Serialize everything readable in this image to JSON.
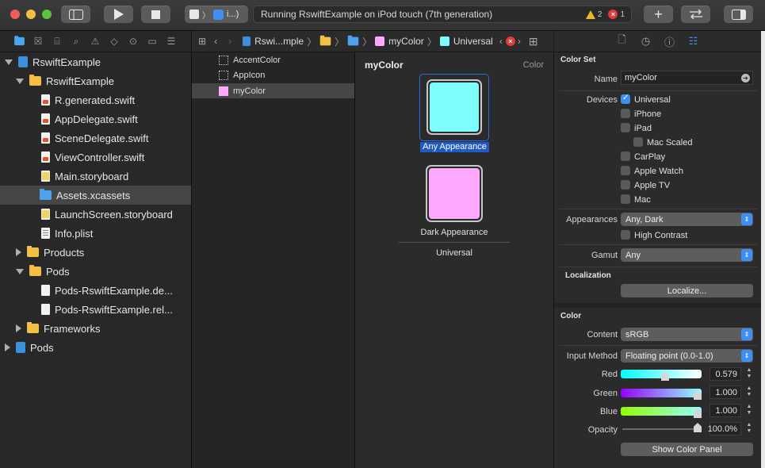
{
  "toolbar": {
    "status_text": "Running RswiftExample on iPod touch (7th generation)",
    "scheme_label": "i...)",
    "warning_count": "2",
    "error_count": "1",
    "colors": {
      "close": "#ee5d57",
      "minimize": "#f5bd3f",
      "zoom": "#5fc43d"
    }
  },
  "navigator": {
    "items": [
      {
        "label": "RswiftExample",
        "icon": "project-icon"
      },
      {
        "label": "RswiftExample",
        "icon": "folder-icon"
      },
      {
        "label": "R.generated.swift",
        "icon": "swift-file-icon"
      },
      {
        "label": "AppDelegate.swift",
        "icon": "swift-file-icon"
      },
      {
        "label": "SceneDelegate.swift",
        "icon": "swift-file-icon"
      },
      {
        "label": "ViewController.swift",
        "icon": "swift-file-icon"
      },
      {
        "label": "Main.storyboard",
        "icon": "storyboard-file-icon"
      },
      {
        "label": "Assets.xcassets",
        "icon": "assets-folder-icon"
      },
      {
        "label": "LaunchScreen.storyboard",
        "icon": "storyboard-file-icon"
      },
      {
        "label": "Info.plist",
        "icon": "plist-file-icon"
      },
      {
        "label": "Products",
        "icon": "folder-icon"
      },
      {
        "label": "Pods",
        "icon": "folder-icon"
      },
      {
        "label": "Pods-RswiftExample.de...",
        "icon": "file-icon"
      },
      {
        "label": "Pods-RswiftExample.rel...",
        "icon": "file-icon"
      },
      {
        "label": "Frameworks",
        "icon": "folder-icon"
      },
      {
        "label": "Pods",
        "icon": "project-icon"
      }
    ]
  },
  "jumpbar": {
    "crumbs": [
      "Rswi...mple",
      "myColor",
      "Universal"
    ]
  },
  "asset_list": {
    "items": [
      "AccentColor",
      "AppIcon",
      "myColor"
    ]
  },
  "editor": {
    "title": "myColor",
    "type_label": "Color",
    "any_appearance": "Any Appearance",
    "dark_appearance": "Dark Appearance",
    "universal": "Universal",
    "any_color": "#7ffeff",
    "dark_color": "#ffa8ff"
  },
  "inspector": {
    "color_set_header": "Color Set",
    "name_label": "Name",
    "name_value": "myColor",
    "devices_label": "Devices",
    "devices": [
      {
        "label": "Universal",
        "checked": true
      },
      {
        "label": "iPhone",
        "checked": false
      },
      {
        "label": "iPad",
        "checked": false
      },
      {
        "label": "Mac Scaled",
        "checked": false
      },
      {
        "label": "CarPlay",
        "checked": false
      },
      {
        "label": "Apple Watch",
        "checked": false
      },
      {
        "label": "Apple TV",
        "checked": false
      },
      {
        "label": "Mac",
        "checked": false
      }
    ],
    "appearances_label": "Appearances",
    "appearances_value": "Any, Dark",
    "high_contrast": "High Contrast",
    "gamut_label": "Gamut",
    "gamut_value": "Any",
    "localization_header": "Localization",
    "localize_button": "Localize...",
    "color_header": "Color",
    "content_label": "Content",
    "content_value": "sRGB",
    "input_method_label": "Input Method",
    "input_method_value": "Floating point (0.0-1.0)",
    "red_label": "Red",
    "red_value": "0.579",
    "green_label": "Green",
    "green_value": "1.000",
    "blue_label": "Blue",
    "blue_value": "1.000",
    "opacity_label": "Opacity",
    "opacity_value": "100.0%",
    "show_color_panel": "Show Color Panel",
    "accent_color": "#3e8ef7"
  }
}
